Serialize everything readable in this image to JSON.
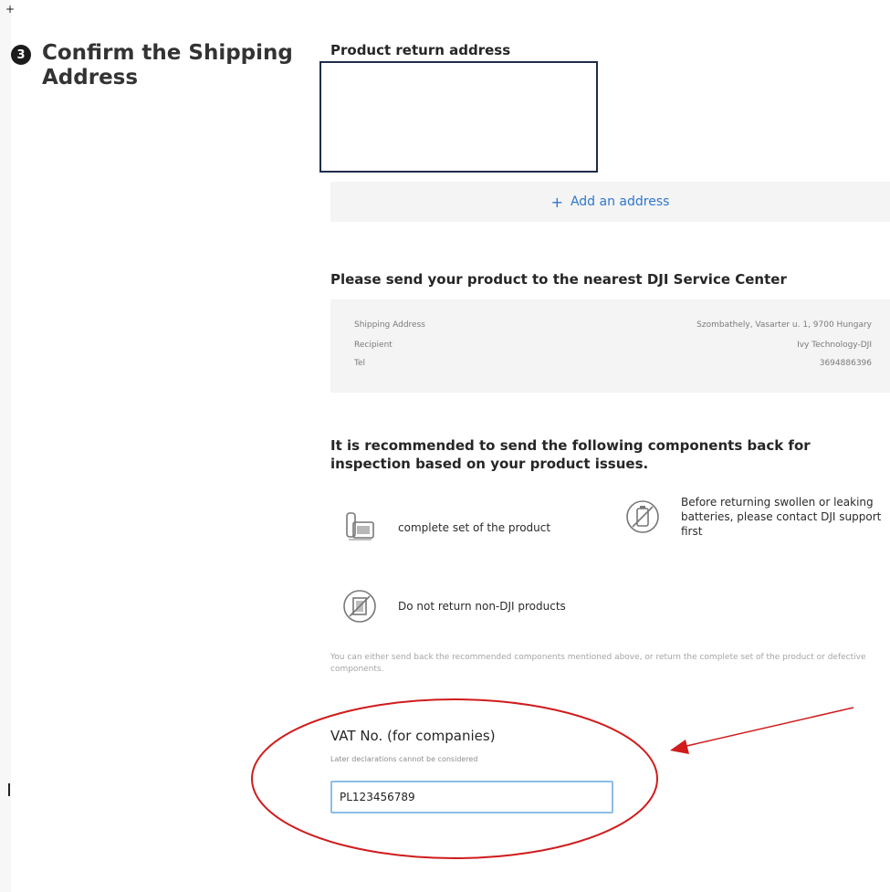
{
  "step": {
    "number": "3",
    "title": "Confirm the Shipping Address"
  },
  "return_address": {
    "title": "Product return address",
    "add_label": "Add an address",
    "add_icon": "plus-icon"
  },
  "service_center": {
    "title": "Please send your product to the nearest DJI Service Center",
    "rows": [
      {
        "label": "Shipping Address",
        "value": "Szombathely, Vasarter u. 1, 9700 Hungary"
      },
      {
        "label": "Recipient",
        "value": "Ivy Technology-DJI"
      },
      {
        "label": "Tel",
        "value": "3694886396"
      }
    ]
  },
  "components": {
    "title": "It is recommended to send the following components back for inspection based on your product issues.",
    "items": [
      {
        "icon": "product-set-icon",
        "text": "complete set of the product"
      },
      {
        "icon": "no-battery-icon",
        "text": "Before returning swollen or leaking batteries, please contact DJI support first"
      },
      {
        "icon": "no-non-dji-product-icon",
        "text": "Do not return non-DJI products"
      }
    ],
    "note": "You can either send back the recommended components mentioned above, or return the complete set of the product or defective components."
  },
  "vat": {
    "label": "VAT No. (for companies)",
    "hint": "Later declarations cannot be considered",
    "value": "PL123456789"
  },
  "annotation_color": "#d01c1c",
  "corner_mark": "+"
}
